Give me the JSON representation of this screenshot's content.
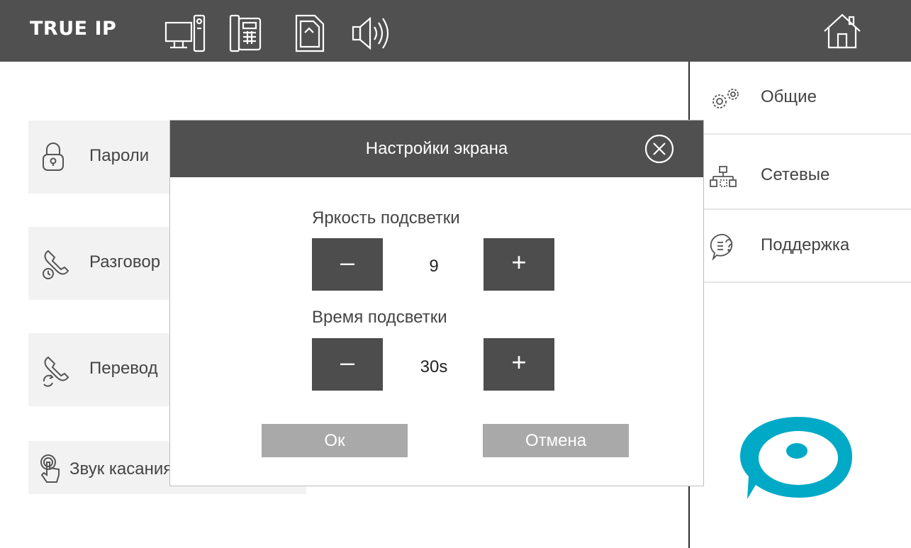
{
  "topbar": {
    "brand": "TRUE IP",
    "icons": [
      "monitor-intercom-icon",
      "indoor-phone-icon",
      "sd-card-icon",
      "speaker-icon"
    ],
    "home_icon": "home-icon",
    "background": "#505050"
  },
  "left_menu": {
    "items": [
      {
        "label": "Пароли",
        "icon": "padlock-icon"
      },
      {
        "label": "Разговор",
        "icon": "call-timer-icon"
      },
      {
        "label": "Перевод",
        "icon": "call-transfer-icon"
      },
      {
        "label": "Звук касания",
        "icon": "touch-icon"
      }
    ]
  },
  "right_menu": {
    "items": [
      {
        "label": "Общие",
        "icon": "gears-icon"
      },
      {
        "label": "Сетевые",
        "icon": "network-icon"
      },
      {
        "label": "Поддержка",
        "icon": "support-chat-icon"
      }
    ]
  },
  "dialog": {
    "title": "Настройки экрана",
    "brightness": {
      "label": "Яркость подсветки",
      "value": "9",
      "minus": "–",
      "plus": "+"
    },
    "timeout": {
      "label": "Время подсветки",
      "value": "30s",
      "minus": "–",
      "plus": "+"
    },
    "ok_label": "Ок",
    "cancel_label": "Отмена"
  },
  "colors": {
    "accent": "#00a9c6",
    "header": "#505050",
    "button": "#4d4d4d",
    "action_button": "#a9a9a9"
  }
}
